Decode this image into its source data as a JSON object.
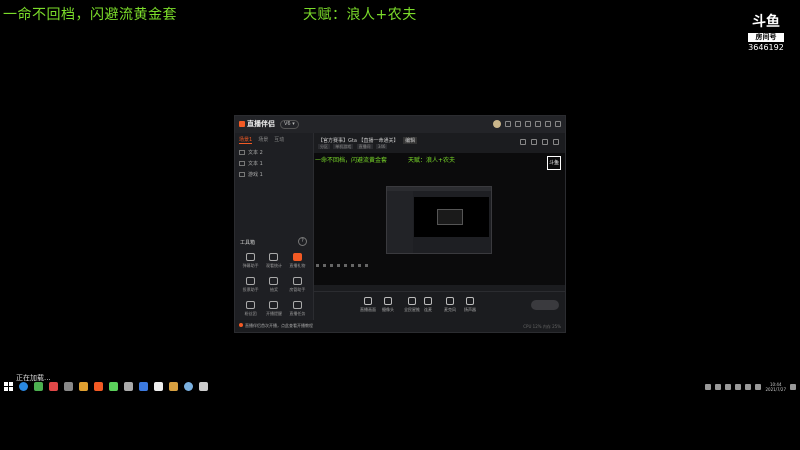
{
  "overlay": {
    "left_text": "一命不回档，闪避流黄金套",
    "right_text": "天赋：浪人+农夫"
  },
  "logo": {
    "brand_mark": "斗鱼",
    "sub_label": "房间号",
    "room_id": "3646192"
  },
  "app": {
    "brand_name": "直播伴侣",
    "version_pill": "V6 ▾",
    "sidebar": {
      "tabs": [
        "场景1",
        "场景",
        "互动"
      ],
      "scenes": [
        "文本 2",
        "文本 1",
        "游戏 1"
      ],
      "toolbox_title": "工具箱",
      "tools": [
        "弹幕助手",
        "观看统计",
        "直播礼物",
        "投票助手",
        "抽奖",
        "房管助手",
        "粉丝团",
        "开播提醒",
        "直播任务"
      ],
      "status_text": "直播伴侣首次开播，点此查看开播教程"
    },
    "main": {
      "room_title": "【官方赛事】Gta 【直播一命通关】",
      "edit_label": "编辑",
      "meta": [
        "分区",
        "单机游戏",
        "直播间",
        "346"
      ],
      "preview_left": "一命不回档，闪避流黄金套",
      "preview_right": "天赋：浪人+农夫",
      "preview_logo": "斗鱼",
      "controls": [
        "直播画面",
        "摄像头",
        "全民星推",
        "连麦",
        "麦克风",
        "扬声器"
      ],
      "footer": "CPU 12%  内存 25%"
    }
  },
  "desktop": {
    "loading_text": "正在加载...",
    "clock_time": "10:44",
    "clock_date": "2021/7/27"
  },
  "colors": {
    "overlay_green": "#7bdc2a",
    "accent": "#f35a24",
    "background": "#000000"
  }
}
